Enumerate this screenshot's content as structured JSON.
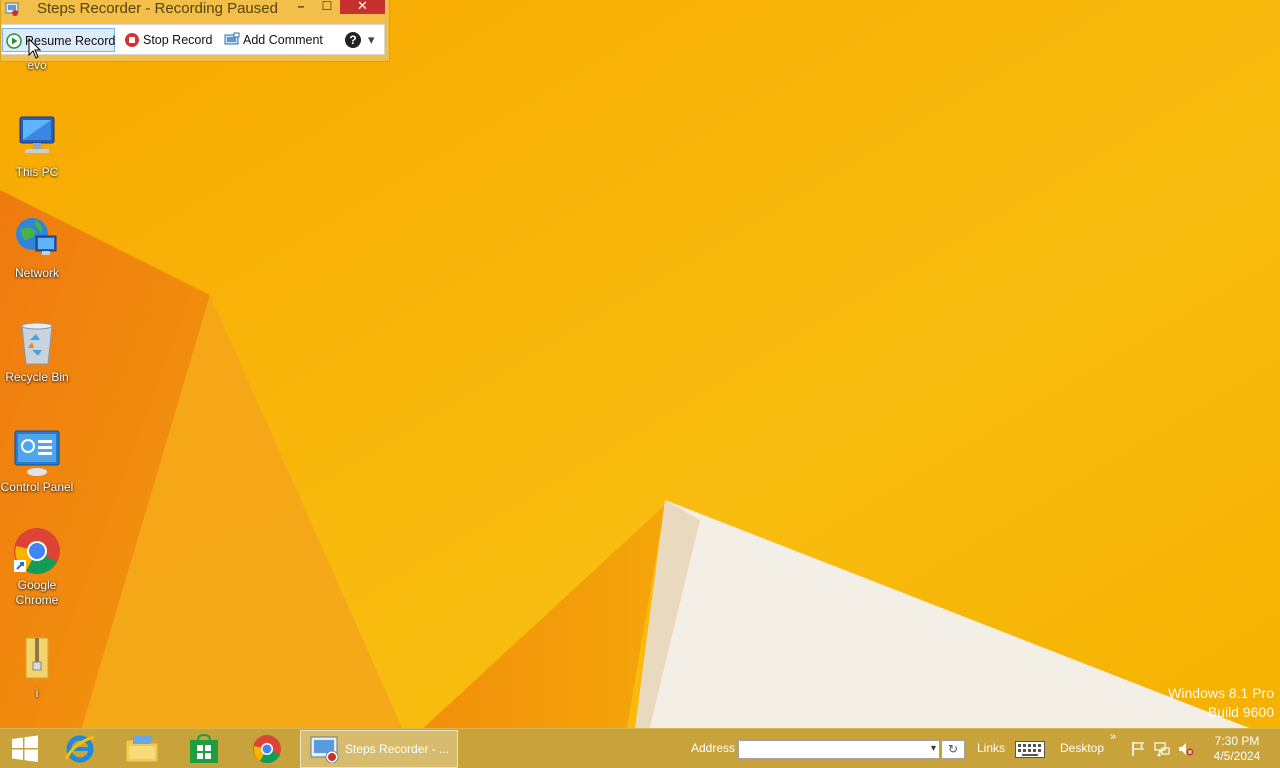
{
  "window": {
    "title": "Steps Recorder - Recording Paused",
    "minimize": "–",
    "maximize": "☐",
    "close": "✕",
    "toolbar": {
      "resume_label": "Resume Record",
      "stop_label": "Stop Record",
      "comment_label": "Add Comment",
      "help_label": "?",
      "dropdown": "▾"
    }
  },
  "desktop": {
    "icons": [
      {
        "label": "evo"
      },
      {
        "label": "This PC"
      },
      {
        "label": "Network"
      },
      {
        "label": "Recycle Bin"
      },
      {
        "label": "Control Panel"
      },
      {
        "label": "Google Chrome"
      },
      {
        "label": "i"
      }
    ]
  },
  "watermark": {
    "line1": "Windows 8.1 Pro",
    "line2": "Build 9600"
  },
  "taskbar": {
    "active_task": "Steps Recorder - ...",
    "address_label": "Address",
    "address_value": "",
    "links_label": "Links",
    "desktop_label": "Desktop",
    "overflow": "»",
    "time": "7:30 PM",
    "date": "4/5/2024"
  },
  "colors": {
    "wallpaper": "#f6b000",
    "accent_close": "#c7312d"
  }
}
